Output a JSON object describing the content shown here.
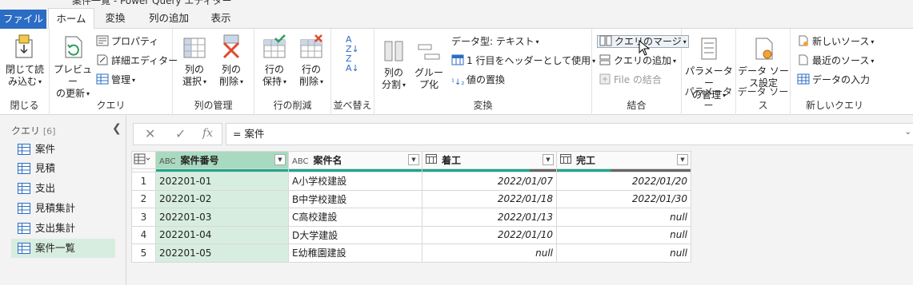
{
  "titlebar": {
    "title": "案件一覧 - Power Query エディター"
  },
  "tabs": {
    "file": "ファイル",
    "home": "ホーム",
    "transform": "変換",
    "add_column": "列の追加",
    "view": "表示"
  },
  "ribbon": {
    "close": {
      "label1": "閉じて読",
      "label2": "み込む",
      "group": "閉じる"
    },
    "query": {
      "preview1": "プレビュー",
      "preview2": "の更新",
      "properties": "プロパティ",
      "advanced_editor": "詳細エディター",
      "manage": "管理",
      "group": "クエリ"
    },
    "columns": {
      "select1": "列の",
      "select2": "選択",
      "remove1": "列の",
      "remove2": "削除",
      "group": "列の管理"
    },
    "rows": {
      "keep1": "行の",
      "keep2": "保持",
      "remove1": "行の",
      "remove2": "削除",
      "group": "行の削減"
    },
    "sort": {
      "group": "並べ替え"
    },
    "transform": {
      "split1": "列の",
      "split2": "分割",
      "groupby1": "グルー",
      "groupby2": "プ化",
      "datatype": "データ型: テキスト",
      "use_header": "1 行目をヘッダーとして使用",
      "replace": "値の置換",
      "group": "変換"
    },
    "combine": {
      "merge": "クエリのマージ",
      "append": "クエリの追加",
      "combine_files": "File の結合",
      "group": "結合"
    },
    "params": {
      "label1": "パラメーター",
      "label2": "の管理",
      "group": "パラメーター"
    },
    "datasource": {
      "label1": "データ ソー",
      "label2": "ス設定",
      "group": "データ ソース"
    },
    "newquery": {
      "new_source": "新しいソース",
      "recent": "最近のソース",
      "enter_data": "データの入力",
      "group": "新しいクエリ"
    }
  },
  "queries": {
    "header": "クエリ",
    "count": "[6]",
    "items": [
      "案件",
      "見積",
      "支出",
      "見積集計",
      "支出集計",
      "案件一覧"
    ],
    "selected_index": 5
  },
  "formula": {
    "cancel": "✕",
    "confirm": "✓",
    "fx": "fx",
    "text": "= 案件"
  },
  "table": {
    "columns": [
      {
        "type": "ABC",
        "name": "案件番号"
      },
      {
        "type": "ABC",
        "name": "案件名"
      },
      {
        "type": "date",
        "name": "着工"
      },
      {
        "type": "date",
        "name": "完工"
      }
    ],
    "rows": [
      {
        "n": "1",
        "id": "202201-01",
        "name": "A小学校建設",
        "start": "2022/01/07",
        "end": "2022/01/20"
      },
      {
        "n": "2",
        "id": "202201-02",
        "name": "B中学校建設",
        "start": "2022/01/18",
        "end": "2022/01/30"
      },
      {
        "n": "3",
        "id": "202201-03",
        "name": "C高校建設",
        "start": "2022/01/13",
        "end": "null"
      },
      {
        "n": "4",
        "id": "202201-04",
        "name": "D大学建設",
        "start": "2022/01/10",
        "end": "null"
      },
      {
        "n": "5",
        "id": "202201-05",
        "name": "E幼稚園建設",
        "start": "null",
        "end": "null"
      }
    ]
  },
  "colors": {
    "file_tab": "#2b6cc4",
    "selected": "#d7ede0",
    "selected_header": "#a9d9bf",
    "quality_ok": "#1aa88a",
    "quality_empty": "#666666"
  }
}
